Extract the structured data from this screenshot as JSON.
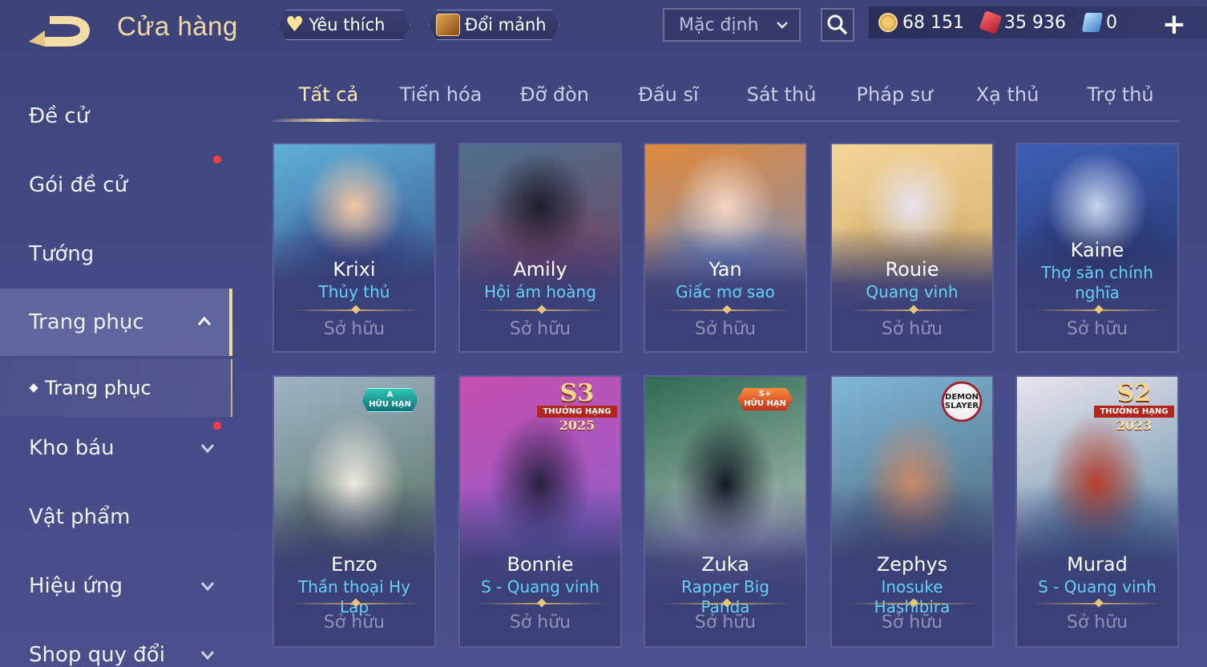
{
  "header": {
    "title": "Cửa hàng",
    "favorites_label": "Yêu thích",
    "exchange_label": "Đổi mảnh",
    "sort_value": "Mặc định",
    "currencies": [
      {
        "icon": "coin-icon",
        "value": "68 151"
      },
      {
        "icon": "gem-icon",
        "value": "35 936"
      },
      {
        "icon": "voucher-icon",
        "value": "0"
      }
    ],
    "add_label": "+"
  },
  "sidebar": {
    "items": [
      {
        "label": "Đề cử"
      },
      {
        "label": "Gói đề cử",
        "notification": true
      },
      {
        "label": "Tướng"
      },
      {
        "label": "Trang phục",
        "expanded": true,
        "active": true
      },
      {
        "label": "Trang phục",
        "sub": true
      },
      {
        "label": "Kho báu",
        "notification": true
      },
      {
        "label": "Vật phẩm"
      },
      {
        "label": "Hiệu ứng"
      },
      {
        "label": "Shop quy đổi"
      }
    ]
  },
  "tabs": [
    {
      "label": "Tất cả",
      "active": true
    },
    {
      "label": "Tiến hóa"
    },
    {
      "label": "Đỡ đòn"
    },
    {
      "label": "Đấu sĩ"
    },
    {
      "label": "Sát thủ"
    },
    {
      "label": "Pháp sư"
    },
    {
      "label": "Xạ thủ"
    },
    {
      "label": "Trợ thủ"
    }
  ],
  "cards": [
    {
      "hero": "Krixi",
      "skin": "Thủy thủ",
      "status": "Sở hữu",
      "badge": null,
      "palette": [
        "#5fb0d9",
        "#f2c8a6",
        "#2c3a7a"
      ]
    },
    {
      "hero": "Amily",
      "skin": "Hội ám hoàng",
      "status": "Sở hữu",
      "badge": null,
      "palette": [
        "#4d6f8a",
        "#1d1f2e",
        "#7a3a5c"
      ]
    },
    {
      "hero": "Yan",
      "skin": "Giấc mơ sao",
      "status": "Sở hữu",
      "badge": null,
      "palette": [
        "#e08a3c",
        "#f5d5c0",
        "#6a8fcf"
      ]
    },
    {
      "hero": "Rouie",
      "skin": "Quang vinh",
      "status": "Sở hữu",
      "badge": null,
      "palette": [
        "#f3d59a",
        "#e8e3f0",
        "#c9a25a"
      ]
    },
    {
      "hero": "Kaine",
      "skin": "Thợ săn chính nghĩa",
      "status": "Sở hữu",
      "badge": null,
      "palette": [
        "#3e5fb5",
        "#c7d5ef",
        "#1e2a5c"
      ]
    },
    {
      "hero": "Enzo",
      "skin": "Thần thoại Hy Lạp",
      "status": "Sở hữu",
      "badge": {
        "type": "tier",
        "line1": "A",
        "line2": "HỮU HẠN"
      },
      "palette": [
        "#9fb3c6",
        "#efeae0",
        "#3e5a3a"
      ]
    },
    {
      "hero": "Bonnie",
      "skin": "S - Quang vinh",
      "status": "Sở hữu",
      "badge": {
        "type": "rank",
        "line1": "S3",
        "line2": "THƯỞNG HẠNG",
        "line3": "2025"
      },
      "palette": [
        "#c64fb0",
        "#2a2140",
        "#7c65d6"
      ]
    },
    {
      "hero": "Zuka",
      "skin": "Rapper Big Panda",
      "status": "Sở hữu",
      "badge": {
        "type": "tier-plus",
        "line1": "S+",
        "line2": "HỮU HẠN"
      },
      "palette": [
        "#2f6b52",
        "#111a22",
        "#e6e6e6"
      ]
    },
    {
      "hero": "Zephys",
      "skin": "Inosuke Hashibira",
      "status": "Sở hữu",
      "badge": {
        "type": "collab",
        "line1": "DEMON",
        "line2": "SLAYER"
      },
      "palette": [
        "#7fb6d6",
        "#c98a6a",
        "#3a4a5a"
      ]
    },
    {
      "hero": "Murad",
      "skin": "S - Quang vinh",
      "status": "Sở hữu",
      "badge": {
        "type": "rank",
        "line1": "S2",
        "line2": "THƯỞNG HẠNG",
        "line3": "2023"
      },
      "palette": [
        "#e9e4ee",
        "#b8402e",
        "#2a6a8a"
      ]
    }
  ]
}
